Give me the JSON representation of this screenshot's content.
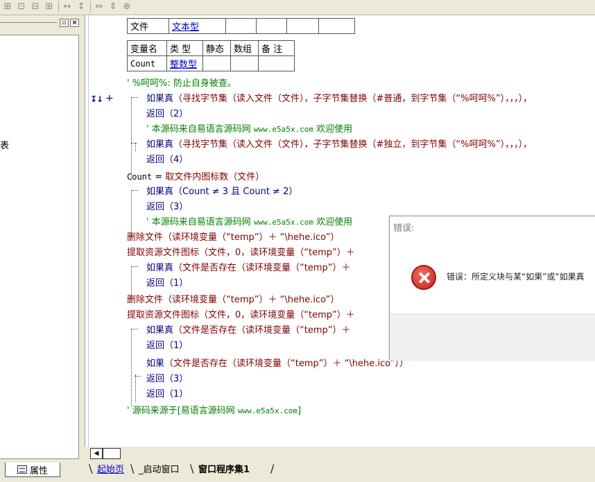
{
  "left_panel": {
    "text_fragment": "表",
    "attr_tab_label": "属性",
    "min_button": "▫",
    "close_button": "×"
  },
  "file_table": {
    "headers": [
      "文件",
      "文本型",
      "",
      "",
      "",
      ""
    ]
  },
  "var_table": {
    "headers": [
      "变量名",
      "类 型",
      "静态",
      "数组",
      "备 注"
    ],
    "row": [
      "Count",
      "整数型",
      "",
      "",
      ""
    ]
  },
  "code": {
    "l1": "' %呵呵%: 防止自身被查。",
    "l2_kw": "如果真",
    "l2_rest": "（寻找字节集（读入文件（文件），子字节集替换（#普通，到字节集（“%呵呵%”），，，），",
    "l3": "返回（2）",
    "l4a": "' 本源码来自易语言源码网 ",
    "l4b": "www.e5a5x.com",
    "l4c": "  欢迎使用",
    "l5_kw": "如果真",
    "l5_rest": "（寻找字节集（读入文件（文件），子字节集替换（#独立，到字节集（“%呵呵%”），，，），",
    "l6": "返回（4）",
    "l7a": "Count",
    "l7b": " = ",
    "l7c": "取文件内图标数（文件）",
    "l8_kw": "如果真",
    "l8_rest": "（Count ≠ 3 且 Count ≠ 2）",
    "l9": "返回（3）",
    "l10a": "' 本源码来自易语言源码网 ",
    "l10b": "www.e5a5x.com",
    "l10c": "  欢迎使用",
    "l11": "删除文件（读环境变量（“temp”）＋ “\\hehe.ico”）",
    "l12": "提取资源文件图标（文件，0，读环境变量（“temp”）＋",
    "l13_kw": "如果真",
    "l13_rest": "（文件是否存在（读环境变量（“temp”）＋",
    "l14": "返回（1）",
    "l15": "删除文件（读环境变量（“temp”）＋ “\\hehe.ico”）",
    "l16": "提取资源文件图标（文件，0，读环境变量（“temp”）＋",
    "l17_kw": "如果真",
    "l17_rest": "（文件是否存在（读环境变量（“temp”）＋",
    "l18": "返回（1）",
    "l19_kw": "如果",
    "l19_rest": "（文件是否存在（读环境变量（“temp”）＋ “\\hehe.ico”））",
    "l20": "返回（3）",
    "l21": "返回（1）",
    "l22a": "' 源码来源于[易语言源码网 ",
    "l22b": "www.e5a5x.com",
    "l22c": "]"
  },
  "tabs": {
    "start": "起始页",
    "launch": "_启动窗口",
    "program": "窗口程序集1"
  },
  "error_dialog": {
    "title": "错误:",
    "message": "错误：所定义块与某“如果”或“如果真"
  },
  "colors": {
    "keyword": "#000080",
    "comment": "#008000",
    "function": "#800000",
    "panel": "#ece9d8",
    "error_red": "#c4231c"
  }
}
